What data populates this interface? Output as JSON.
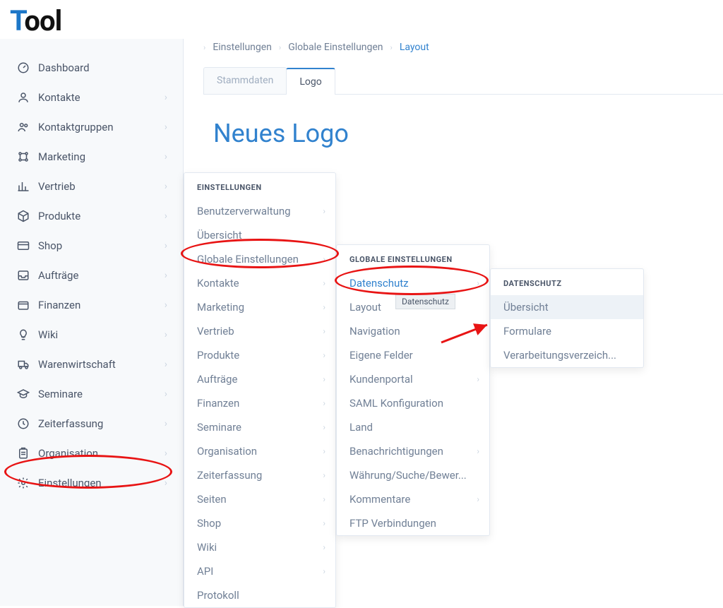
{
  "logo": {
    "t": "T",
    "rest": "ool"
  },
  "sidebar": [
    {
      "icon": "gauge",
      "label": "Dashboard",
      "expand": false
    },
    {
      "icon": "user",
      "label": "Kontakte",
      "expand": true
    },
    {
      "icon": "users",
      "label": "Kontaktgruppen",
      "expand": true
    },
    {
      "icon": "spark",
      "label": "Marketing",
      "expand": true
    },
    {
      "icon": "bars",
      "label": "Vertrieb",
      "expand": true
    },
    {
      "icon": "cube",
      "label": "Produkte",
      "expand": true
    },
    {
      "icon": "card",
      "label": "Shop",
      "expand": true
    },
    {
      "icon": "inbox",
      "label": "Aufträge",
      "expand": true
    },
    {
      "icon": "wallet",
      "label": "Finanzen",
      "expand": true
    },
    {
      "icon": "bulb",
      "label": "Wiki",
      "expand": true
    },
    {
      "icon": "truck",
      "label": "Warenwirtschaft",
      "expand": true
    },
    {
      "icon": "grad",
      "label": "Seminare",
      "expand": true
    },
    {
      "icon": "clock",
      "label": "Zeiterfassung",
      "expand": true
    },
    {
      "icon": "clip",
      "label": "Organisation",
      "expand": true
    },
    {
      "icon": "gear",
      "label": "Einstellungen",
      "expand": true
    }
  ],
  "breadcrumbs": [
    "Einstellungen",
    "Globale Einstellungen",
    "Layout"
  ],
  "tabs": [
    "Stammdaten",
    "Logo"
  ],
  "active_tab": 1,
  "page_title": "Neues Logo",
  "hidden_filename": "Neues Logo.gif",
  "fly1": {
    "header": "EINSTELLUNGEN",
    "items": [
      {
        "label": "Benutzerverwaltung",
        "sub": true
      },
      {
        "label": "Übersicht",
        "sub": false
      },
      {
        "label": "Globale Einstellungen",
        "sub": true
      },
      {
        "label": "Kontakte",
        "sub": true
      },
      {
        "label": "Marketing",
        "sub": true
      },
      {
        "label": "Vertrieb",
        "sub": true
      },
      {
        "label": "Produkte",
        "sub": true
      },
      {
        "label": "Aufträge",
        "sub": true
      },
      {
        "label": "Finanzen",
        "sub": true
      },
      {
        "label": "Seminare",
        "sub": true
      },
      {
        "label": "Organisation",
        "sub": true
      },
      {
        "label": "Zeiterfassung",
        "sub": true
      },
      {
        "label": "Seiten",
        "sub": true
      },
      {
        "label": "Shop",
        "sub": true
      },
      {
        "label": "Wiki",
        "sub": true
      },
      {
        "label": "API",
        "sub": true
      },
      {
        "label": "Protokoll",
        "sub": false
      }
    ]
  },
  "fly2": {
    "header": "GLOBALE EINSTELLUNGEN",
    "items": [
      {
        "label": "Datenschutz",
        "sub": true,
        "hl": true
      },
      {
        "label": "Layout",
        "sub": false
      },
      {
        "label": "Navigation",
        "sub": false
      },
      {
        "label": "Eigene Felder",
        "sub": false
      },
      {
        "label": "Kundenportal",
        "sub": true
      },
      {
        "label": "SAML Konfiguration",
        "sub": false
      },
      {
        "label": "Land",
        "sub": false
      },
      {
        "label": "Benachrichtigungen",
        "sub": true
      },
      {
        "label": "Währung/Suche/Bewer...",
        "sub": false
      },
      {
        "label": "Kommentare",
        "sub": true
      },
      {
        "label": "FTP Verbindungen",
        "sub": false
      }
    ]
  },
  "fly3": {
    "header": "DATENSCHUTZ",
    "items": [
      {
        "label": "Übersicht",
        "hover": true
      },
      {
        "label": "Formulare"
      },
      {
        "label": "Verarbeitungsverzeich..."
      }
    ]
  },
  "tooltip": "Datenschutz"
}
